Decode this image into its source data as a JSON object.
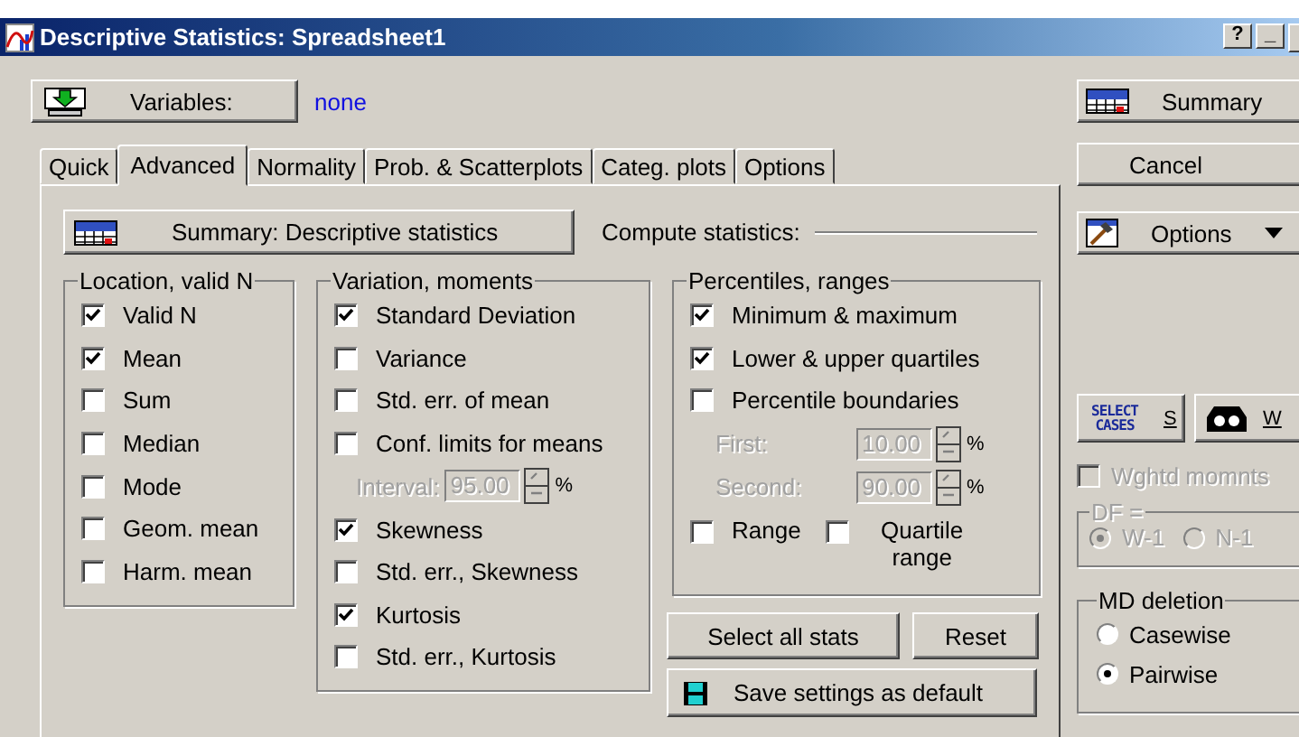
{
  "window": {
    "title": "Descriptive Statistics: Spreadsheet1",
    "controls": [
      "?",
      "_"
    ]
  },
  "variables": {
    "button": "Variables:",
    "value": "none"
  },
  "tabs": [
    {
      "label": "Quick",
      "selected": false
    },
    {
      "label": "Advanced",
      "selected": true
    },
    {
      "label": "Normality",
      "selected": false
    },
    {
      "label": "Prob. & Scatterplots",
      "selected": false
    },
    {
      "label": "Categ. plots",
      "selected": false
    },
    {
      "label": "Options",
      "selected": false
    }
  ],
  "summary_button": "Summary: Descriptive statistics",
  "compute_label": "Compute statistics:",
  "groups": [
    {
      "title": "Location, valid N",
      "items": [
        {
          "kind": "checkbox",
          "label": "Valid N",
          "checked": true
        },
        {
          "kind": "checkbox",
          "label": "Mean",
          "checked": true
        },
        {
          "kind": "checkbox",
          "label": "Sum",
          "checked": false
        },
        {
          "kind": "checkbox",
          "label": "Median",
          "checked": false
        },
        {
          "kind": "checkbox",
          "label": "Mode",
          "checked": false
        },
        {
          "kind": "checkbox",
          "label": "Geom. mean",
          "checked": false
        },
        {
          "kind": "checkbox",
          "label": "Harm. mean",
          "checked": false
        }
      ]
    },
    {
      "title": "Variation, moments",
      "items": [
        {
          "kind": "checkbox",
          "label": "Standard Deviation",
          "checked": true
        },
        {
          "kind": "checkbox",
          "label": "Variance",
          "checked": false
        },
        {
          "kind": "checkbox",
          "label": "Std. err. of mean",
          "checked": false
        },
        {
          "kind": "checkbox",
          "label": "Conf. limits for means",
          "checked": false
        },
        {
          "kind": "spin",
          "label": "Interval:",
          "value": "95.00",
          "unit": "%",
          "disabled": true
        },
        {
          "kind": "checkbox",
          "label": "Skewness",
          "checked": true
        },
        {
          "kind": "checkbox",
          "label": "Std. err., Skewness",
          "checked": false
        },
        {
          "kind": "checkbox",
          "label": "Kurtosis",
          "checked": true
        },
        {
          "kind": "checkbox",
          "label": "Std. err., Kurtosis",
          "checked": false
        }
      ]
    },
    {
      "title": "Percentiles, ranges",
      "items": [
        {
          "kind": "checkbox",
          "label": "Minimum & maximum",
          "checked": true
        },
        {
          "kind": "checkbox",
          "label": "Lower & upper quartiles",
          "checked": true
        },
        {
          "kind": "checkbox",
          "label": "Percentile boundaries",
          "checked": false
        },
        {
          "kind": "spin",
          "label": "First:",
          "value": "10.00",
          "unit": "%",
          "disabled": true
        },
        {
          "kind": "spin",
          "label": "Second:",
          "value": "90.00",
          "unit": "%",
          "disabled": true
        },
        {
          "kind": "pair",
          "items": [
            {
              "label": "Range",
              "checked": false
            },
            {
              "label": "Quartile range",
              "checked": false
            }
          ]
        }
      ]
    }
  ],
  "actions": {
    "select_all": "Select all stats",
    "reset": "Reset",
    "save": "Save settings as default"
  },
  "side": {
    "buttons": [
      {
        "kind": "summary",
        "label": "Summary"
      },
      {
        "kind": "plain",
        "label": "Cancel"
      },
      {
        "kind": "menu",
        "label": "Options"
      }
    ],
    "select_cases": {
      "icon_text": "SELECT CASES",
      "key": "S"
    },
    "weight": {
      "key": "W"
    },
    "weighted": {
      "label": "Wghtd momnts",
      "checked": false,
      "disabled": true
    },
    "df": {
      "title": "DF =",
      "disabled": true,
      "options": [
        {
          "label": "W-1",
          "selected": true
        },
        {
          "label": "N-1",
          "selected": false
        }
      ]
    },
    "md": {
      "title": "MD deletion",
      "options": [
        {
          "label": "Casewise",
          "selected": false
        },
        {
          "label": "Pairwise",
          "selected": true
        }
      ]
    }
  }
}
